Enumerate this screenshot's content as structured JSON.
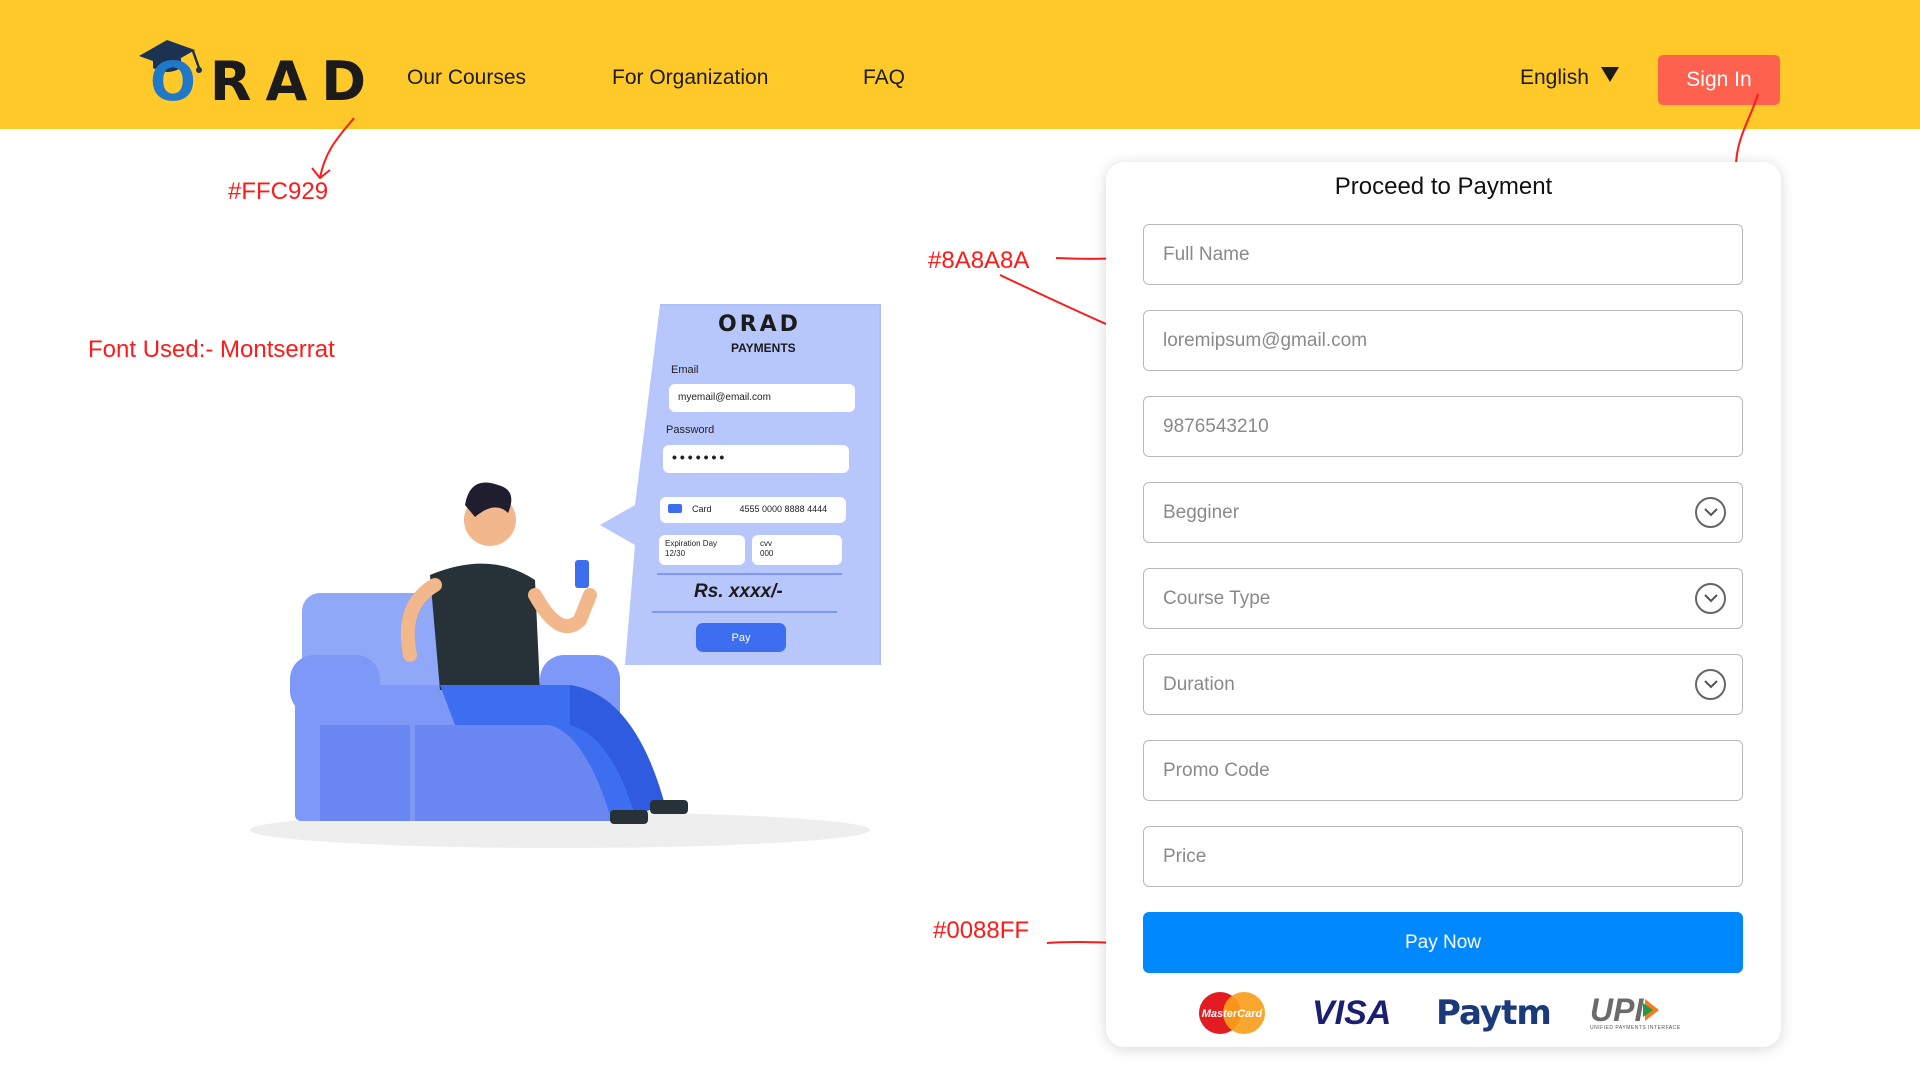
{
  "header": {
    "logo_text": "ORAD",
    "nav": [
      "Our Courses",
      "For Organization",
      "FAQ"
    ],
    "language": "English",
    "signin_label": "Sign In"
  },
  "annotations": {
    "header_color": "#FFC929",
    "signin_color": "#FF614F",
    "input_color": "#8A8A8A",
    "button_color": "#0088FF",
    "font_note": "Font Used:- Montserrat"
  },
  "illustration": {
    "logo_text": "ORAD",
    "subtitle": "PAYMENTS",
    "email_label": "Email",
    "email_value": "myemail@email.com",
    "password_label": "Password",
    "password_value": "•••••••",
    "card_label": "Card",
    "card_number": "4555 0000 8888 4444",
    "expiration_label": "Expiration Day",
    "expiration_value": "12/30",
    "cvv_label": "cvv",
    "cvv_value": "000",
    "amount": "Rs. xxxx/-",
    "pay_label": "Pay"
  },
  "payment": {
    "title": "Proceed to Payment",
    "full_name_placeholder": "Full Name",
    "email_value": "loremipsum@gmail.com",
    "phone_value": "9876543210",
    "level_value": "Begginer",
    "course_type_value": "Course Type",
    "duration_value": "Duration",
    "promo_placeholder": "Promo Code",
    "price_placeholder": "Price",
    "pay_button": "Pay Now",
    "brands": [
      "MasterCard",
      "VISA",
      "Paytm",
      "UPI"
    ],
    "upi_caption": "UNIFIED PAYMENTS INTERFACE"
  },
  "colors": {
    "header_bg": "#FFC929",
    "signin_bg": "#FF614F",
    "placeholder": "#8A8A8A",
    "pay_button_bg": "#0088FF"
  }
}
